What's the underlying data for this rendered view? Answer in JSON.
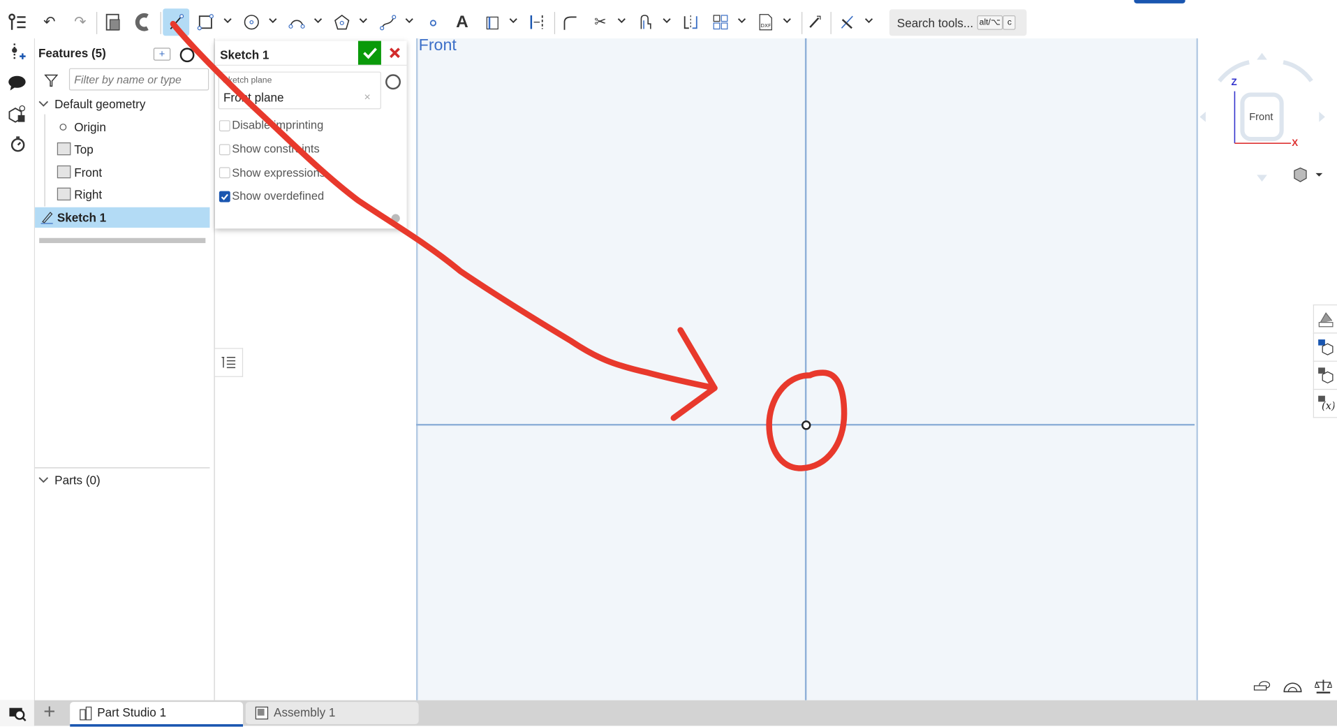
{
  "toolbar": {
    "search_placeholder": "Search tools...",
    "shortcut_key1": "alt/⌥",
    "shortcut_key2": "c",
    "active_tool": "line"
  },
  "features_panel": {
    "title": "Features (5)",
    "filter_placeholder": "Filter by name or type",
    "default_geometry_label": "Default geometry",
    "items": [
      {
        "label": "Origin",
        "icon": "origin-icon"
      },
      {
        "label": "Top",
        "icon": "plane-icon"
      },
      {
        "label": "Front",
        "icon": "plane-icon"
      },
      {
        "label": "Right",
        "icon": "plane-icon"
      },
      {
        "label": "Sketch 1",
        "icon": "sketch-icon",
        "selected": true
      }
    ],
    "parts_label": "Parts (0)"
  },
  "sketch_dialog": {
    "title": "Sketch 1",
    "plane_label": "Sketch plane",
    "plane_value": "Front plane",
    "options": [
      {
        "label": "Disable imprinting",
        "checked": false
      },
      {
        "label": "Show constraints",
        "checked": false
      },
      {
        "label": "Show expressions",
        "checked": false
      },
      {
        "label": "Show overdefined",
        "checked": true
      }
    ]
  },
  "viewport": {
    "view_label": "Front",
    "view_cube_label": "Front",
    "axis_z": "Z",
    "axis_x": "X"
  },
  "tabs": [
    {
      "label": "Part Studio 1",
      "active": true
    },
    {
      "label": "Assembly 1",
      "active": false
    }
  ],
  "colors": {
    "accent": "#1a56b0",
    "confirm": "#0a9a0a",
    "cancel": "#d22b2b",
    "selection": "#b3dbf5",
    "annotation": "#e8392c",
    "axis": "#8fb0d8"
  }
}
